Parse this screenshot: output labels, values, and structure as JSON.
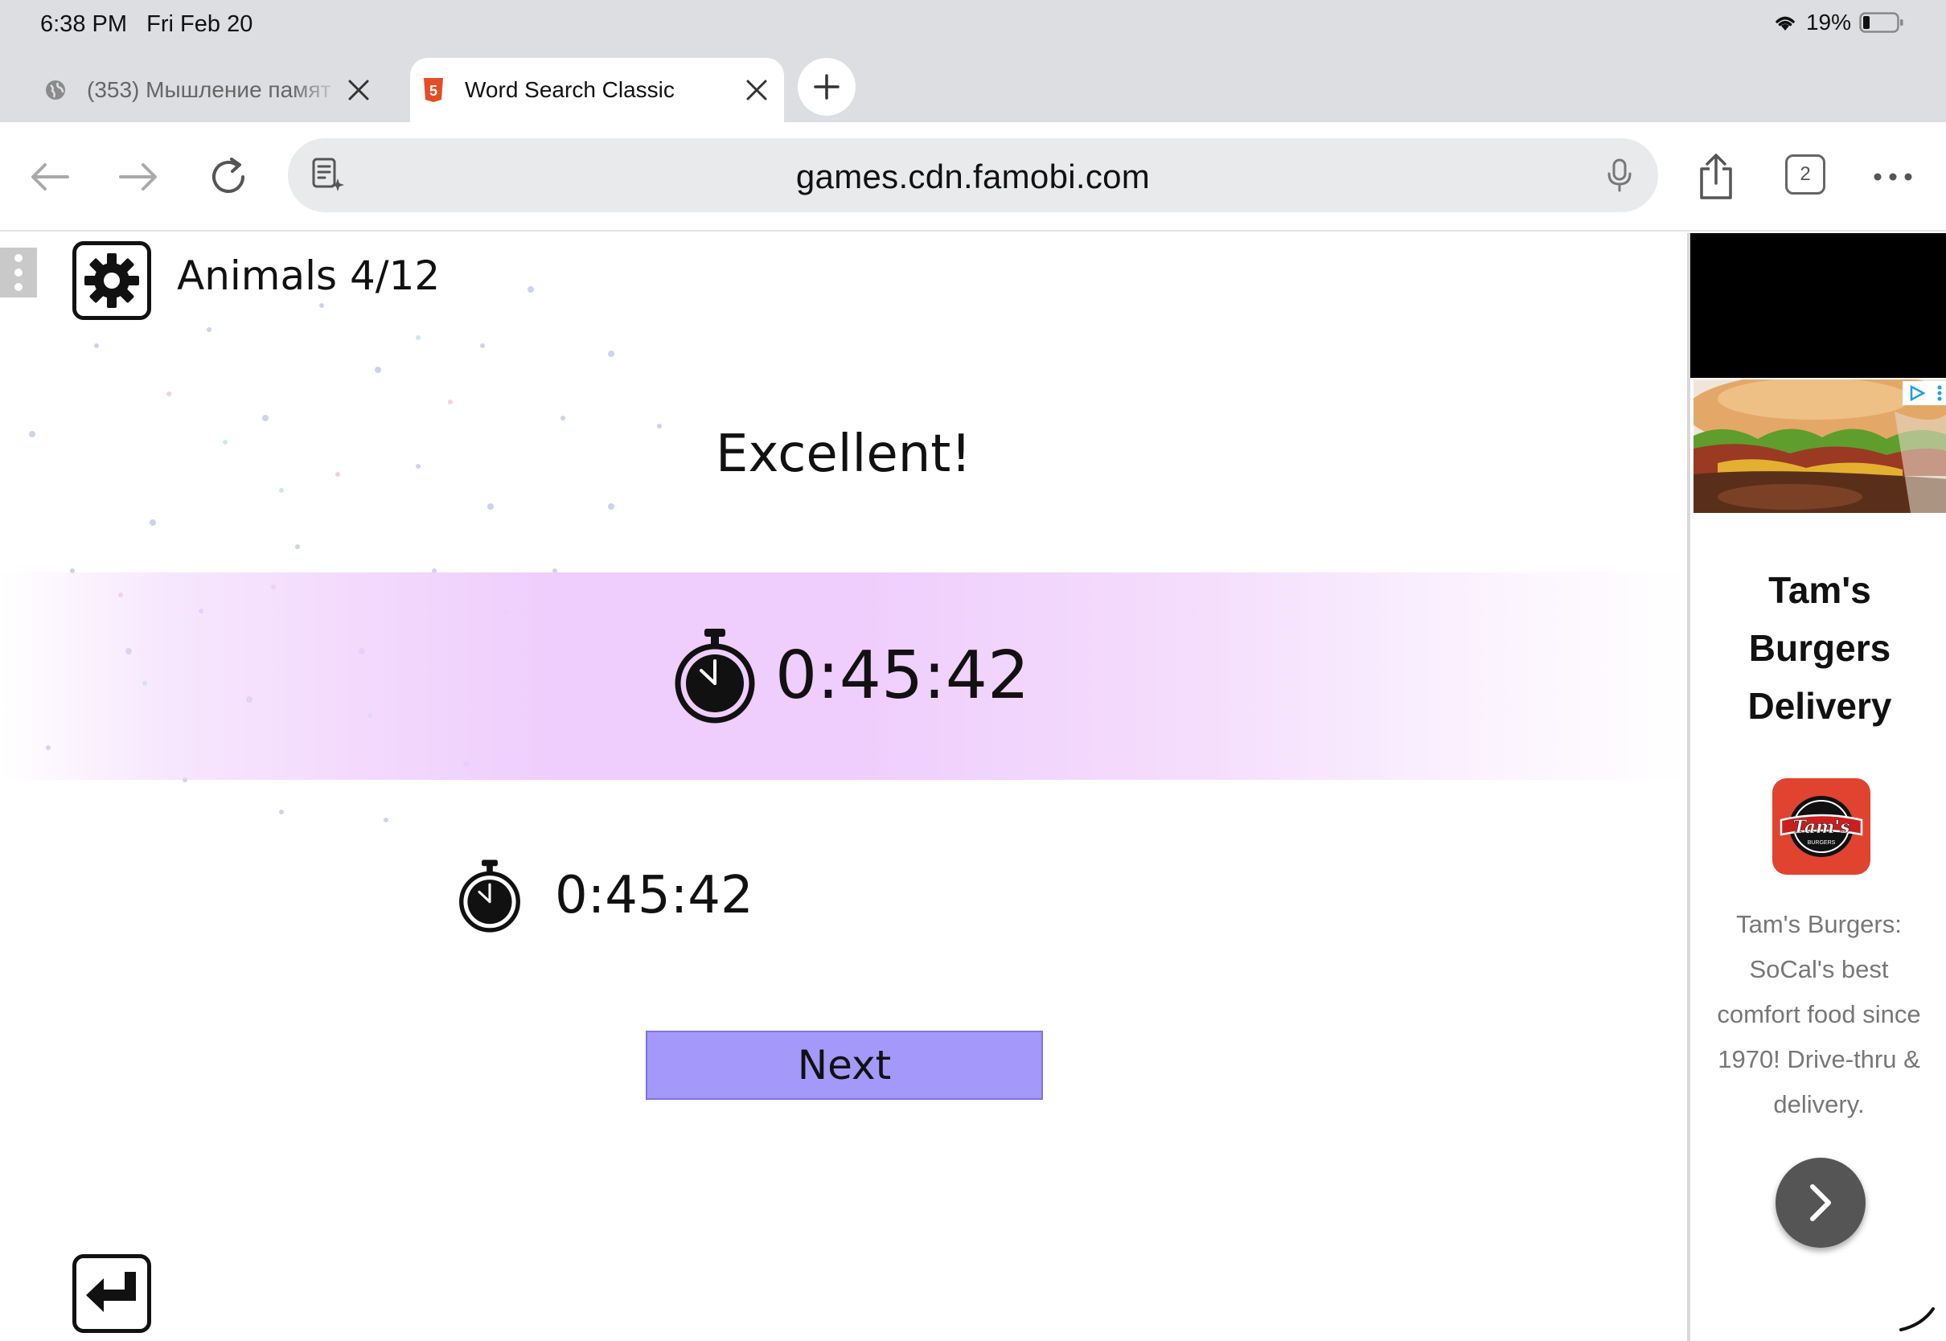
{
  "status_bar": {
    "time": "6:38 PM",
    "date": "Fri Feb 20",
    "battery": "19%",
    "wifi_icon": "wifi-icon",
    "battery_icon": "battery-icon"
  },
  "tabs": [
    {
      "title": "(353) Мышление памят",
      "favicon": "globe-icon",
      "active": false
    },
    {
      "title": "Word Search Classic",
      "favicon": "html5-icon",
      "active": true
    }
  ],
  "toolbar": {
    "url": "games.cdn.famobi.com",
    "tab_count": "2"
  },
  "game": {
    "level": "Animals 4/12",
    "headline": "Excellent!",
    "current_time": "0:45:42",
    "best_time": "0:45:42",
    "next_label": "Next",
    "band_color": "#efcdfc",
    "next_color": "#a499fb"
  },
  "ad": {
    "brand_lines": [
      "Tam's",
      "Burgers",
      "Delivery"
    ],
    "logo_text": "Tam's",
    "logo_sub": "BURGERS",
    "description_lines": [
      "Tam's Burgers:",
      "SoCal's best",
      "comfort food since",
      "1970! Drive-thru &",
      "delivery."
    ],
    "logo_color": "#e0432f"
  }
}
